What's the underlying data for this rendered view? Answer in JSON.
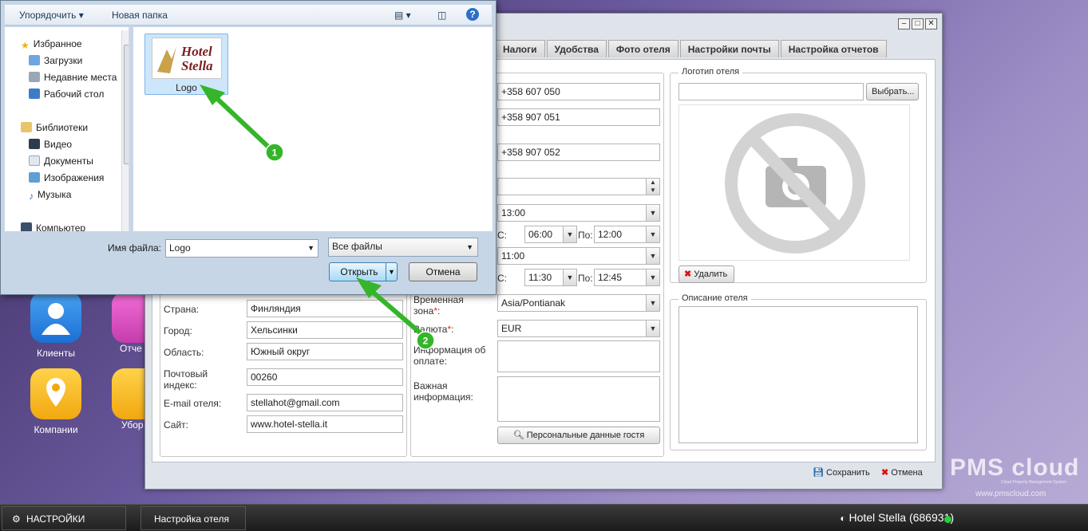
{
  "desktop": {
    "icons": [
      {
        "label": "Клиенты",
        "icon": "user-icon"
      },
      {
        "label": "Отче",
        "icon": "reports-icon"
      },
      {
        "label": "Компании",
        "icon": "location-pin-icon"
      },
      {
        "label": "Убор",
        "icon": "cleaning-icon"
      }
    ]
  },
  "taskbar": {
    "settings_label": "НАСТРОЙКИ",
    "task_label": "Настройка отеля",
    "hotel_status": "Hotel Stella (686931)"
  },
  "watermark": {
    "brand": "PMS cloud",
    "tagline": "Cloud Property Management System",
    "url": "www.pmscloud.com"
  },
  "main_window": {
    "tabs": [
      "Налоги",
      "Удобства",
      "Фото отеля",
      "Настройки почты",
      "Настройка отчетов"
    ],
    "contact_fields": [
      "+358 607 050",
      "+358 907 051",
      "+358 907 052"
    ],
    "checkin_time": "13:00",
    "break1": {
      "from_label": "С:",
      "from": "06:00",
      "to_label": "По:",
      "to": "12:00"
    },
    "checkout_time": "11:00",
    "break2": {
      "from_label": "С:",
      "from": "11:30",
      "to_label": "По:",
      "to": "12:45"
    },
    "timezone_label": "Временная зона",
    "timezone": "Asia/Pontianak",
    "currency_label": "Валюта",
    "currency": "EUR",
    "payment_info_label": "Информация об оплате:",
    "important_info_label": "Важная информация:",
    "guest_data_button": "Персональные данные гостя",
    "address": {
      "country_label": "Страна:",
      "country": "Финляндия",
      "city_label": "Город:",
      "city": "Хельсинки",
      "region_label": "Область:",
      "region": "Южный округ",
      "postal_label": "Почтовый индекс:",
      "postal": "00260",
      "email_label": "E-mail отеля:",
      "email": "stellahot@gmail.com",
      "site_label": "Сайт:",
      "site": "www.hotel-stella.it"
    },
    "logo_section": {
      "legend": "Логотип отеля",
      "choose_button": "Выбрать...",
      "delete_button": "Удалить"
    },
    "description_section": {
      "legend": "Описание отеля"
    },
    "footer": {
      "save": "Сохранить",
      "cancel": "Отмена"
    }
  },
  "file_dialog": {
    "toolbar": {
      "organize": "Упорядочить",
      "new_folder": "Новая папка"
    },
    "nav": {
      "favorites": "Избранное",
      "downloads": "Загрузки",
      "recent": "Недавние места",
      "desktop": "Рабочий стол",
      "libraries": "Библиотеки",
      "video": "Видео",
      "documents": "Документы",
      "images": "Изображения",
      "music": "Музыка",
      "computer": "Компьютер"
    },
    "file": {
      "name": "Logo",
      "thumb_line1": "Hotel",
      "thumb_line2": "Stella"
    },
    "filename_label": "Имя файла:",
    "filename_value": "Logo",
    "filter": "Все файлы",
    "open_button": "Открыть",
    "cancel_button": "Отмена"
  },
  "annotations": {
    "step1": "1",
    "step2": "2",
    "color": "#35b52a"
  }
}
